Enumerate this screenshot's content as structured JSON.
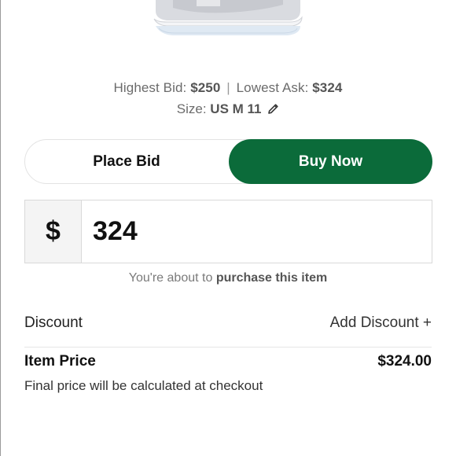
{
  "product": {
    "image_alt": "sneaker"
  },
  "bid_info": {
    "highest_bid_label": "Highest Bid:",
    "highest_bid_value": "$250",
    "separator": "|",
    "lowest_ask_label": "Lowest Ask:",
    "lowest_ask_value": "$324"
  },
  "size": {
    "label": "Size:",
    "value": "US M 11",
    "edit_icon": "pencil-icon"
  },
  "toggle": {
    "place_bid_label": "Place Bid",
    "buy_now_label": "Buy Now",
    "selected": "Buy Now"
  },
  "price_input": {
    "currency_symbol": "$",
    "value": "324"
  },
  "notice": {
    "prefix": "You're about to",
    "action": "purchase this item"
  },
  "discount": {
    "label": "Discount",
    "action_label": "Add Discount +"
  },
  "item_price": {
    "label": "Item Price",
    "value": "$324.00"
  },
  "final_note": "Final price will be calculated at checkout",
  "colors": {
    "accent": "#0b6b3a"
  }
}
